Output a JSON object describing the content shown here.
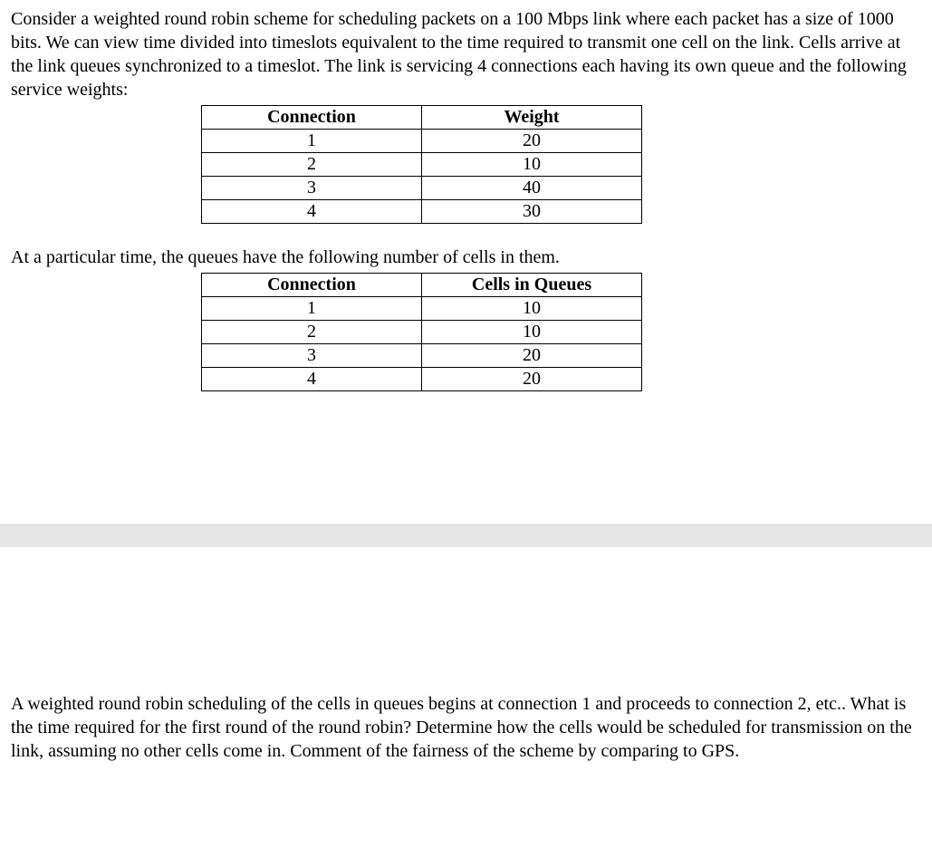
{
  "para1": "Consider a weighted round robin scheme for scheduling packets on a 100 Mbps link where each packet has a size of 1000 bits. We can view time divided into timeslots equivalent to the time required to transmit one cell on the link. Cells arrive at the link queues synchronized to a timeslot. The link is servicing 4 connections each having its own queue and the following service weights:",
  "table1": {
    "headers": {
      "c1": "Connection",
      "c2": "Weight"
    },
    "rows": [
      {
        "c1": "1",
        "c2": "20"
      },
      {
        "c1": "2",
        "c2": "10"
      },
      {
        "c1": "3",
        "c2": "40"
      },
      {
        "c1": "4",
        "c2": "30"
      }
    ]
  },
  "para2": "At a particular time, the queues have the following number of cells in them.",
  "table2": {
    "headers": {
      "c1": "Connection",
      "c2": "Cells in Queues"
    },
    "rows": [
      {
        "c1": "1",
        "c2": "10"
      },
      {
        "c1": "2",
        "c2": "10"
      },
      {
        "c1": "3",
        "c2": "20"
      },
      {
        "c1": "4",
        "c2": "20"
      }
    ]
  },
  "para3": "A weighted round robin scheduling of the cells in queues begins at connection 1 and proceeds to connection 2, etc..  What is the time required for the first round of the round robin? Determine how the cells would be scheduled for transmission on the link, assuming no other cells come in. Comment of the fairness of the scheme by comparing to GPS."
}
